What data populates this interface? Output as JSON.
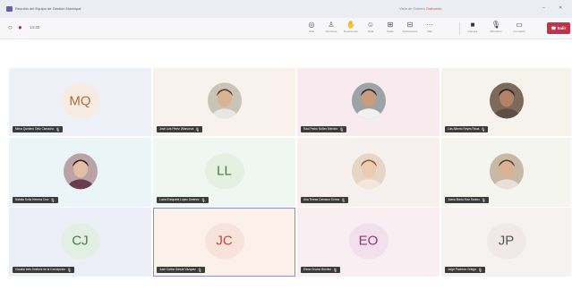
{
  "titlebar": {
    "title": "Reunión del Equipo de Gestión Municipal",
    "right_text": "Vista de Galería",
    "right_accent": "Grabando"
  },
  "toolbar": {
    "time": "14:32",
    "tools": [
      {
        "label": "Chat"
      },
      {
        "label": "Personas"
      },
      {
        "label": "Reacciones"
      },
      {
        "label": "Vista"
      },
      {
        "label": "Salas"
      },
      {
        "label": "Aplicaciones"
      },
      {
        "label": "Más"
      },
      {
        "label": "Cámara"
      },
      {
        "label": "Micrófono"
      },
      {
        "label": "Compartir"
      }
    ],
    "leave_label": "Salir"
  },
  "participants": [
    {
      "name": "Mirna Quintero Ortiz Camacho",
      "initials": "MQ",
      "bg": "#eef0f8",
      "avatar_bg": "#f6ece4",
      "initials_color": "#b46d33"
    },
    {
      "name": "José Luis Pérez Villanueva",
      "initials": "",
      "bg": "#f8f1ec",
      "photo": "man-light"
    },
    {
      "name": "Raúl Pedro Núñez Méndez",
      "initials": "",
      "bg": "#f7ebef",
      "photo": "man-beard"
    },
    {
      "name": "Luis Alberto Reyes Rivas",
      "initials": "",
      "bg": "#f6f3ed",
      "photo": "man-dark"
    },
    {
      "name": "Natalia Sofía Herrera Cruz",
      "initials": "",
      "bg": "#ebf4f6",
      "photo": "woman-dark-hair"
    },
    {
      "name": "Lucía Enriqueta López Jiménez",
      "initials": "LL",
      "bg": "#eef7f2",
      "avatar_bg": "#e3f0e2",
      "initials_color": "#4a7a45"
    },
    {
      "name": "Ana Teresa Carrasco Ochoa",
      "initials": "",
      "bg": "#f6f1ee",
      "photo": "woman-blonde"
    },
    {
      "name": "Juana María Ruiz Santos",
      "initials": "",
      "bg": "#f5f5ef",
      "photo": "woman-brown"
    },
    {
      "name": "Claudia Inés Jiménez de la Concepción",
      "initials": "CJ",
      "bg": "#eceff7",
      "avatar_bg": "#e4efe3",
      "initials_color": "#4a7a45"
    },
    {
      "name": "Juan Carlos García Vázquez",
      "initials": "JC",
      "bg": "#fbf0ea",
      "avatar_bg": "#f7e3dc",
      "initials_color": "#c24a37",
      "active": true
    },
    {
      "name": "Elena Orozco Benítez",
      "initials": "EO",
      "bg": "#f9eef2",
      "avatar_bg": "#f2e0ec",
      "initials_color": "#8a3b73"
    },
    {
      "name": "Jorge Pacheco Ortega",
      "initials": "JP",
      "bg": "#f4f3f1",
      "avatar_bg": "#efe9e8",
      "initials_color": "#555555"
    }
  ]
}
